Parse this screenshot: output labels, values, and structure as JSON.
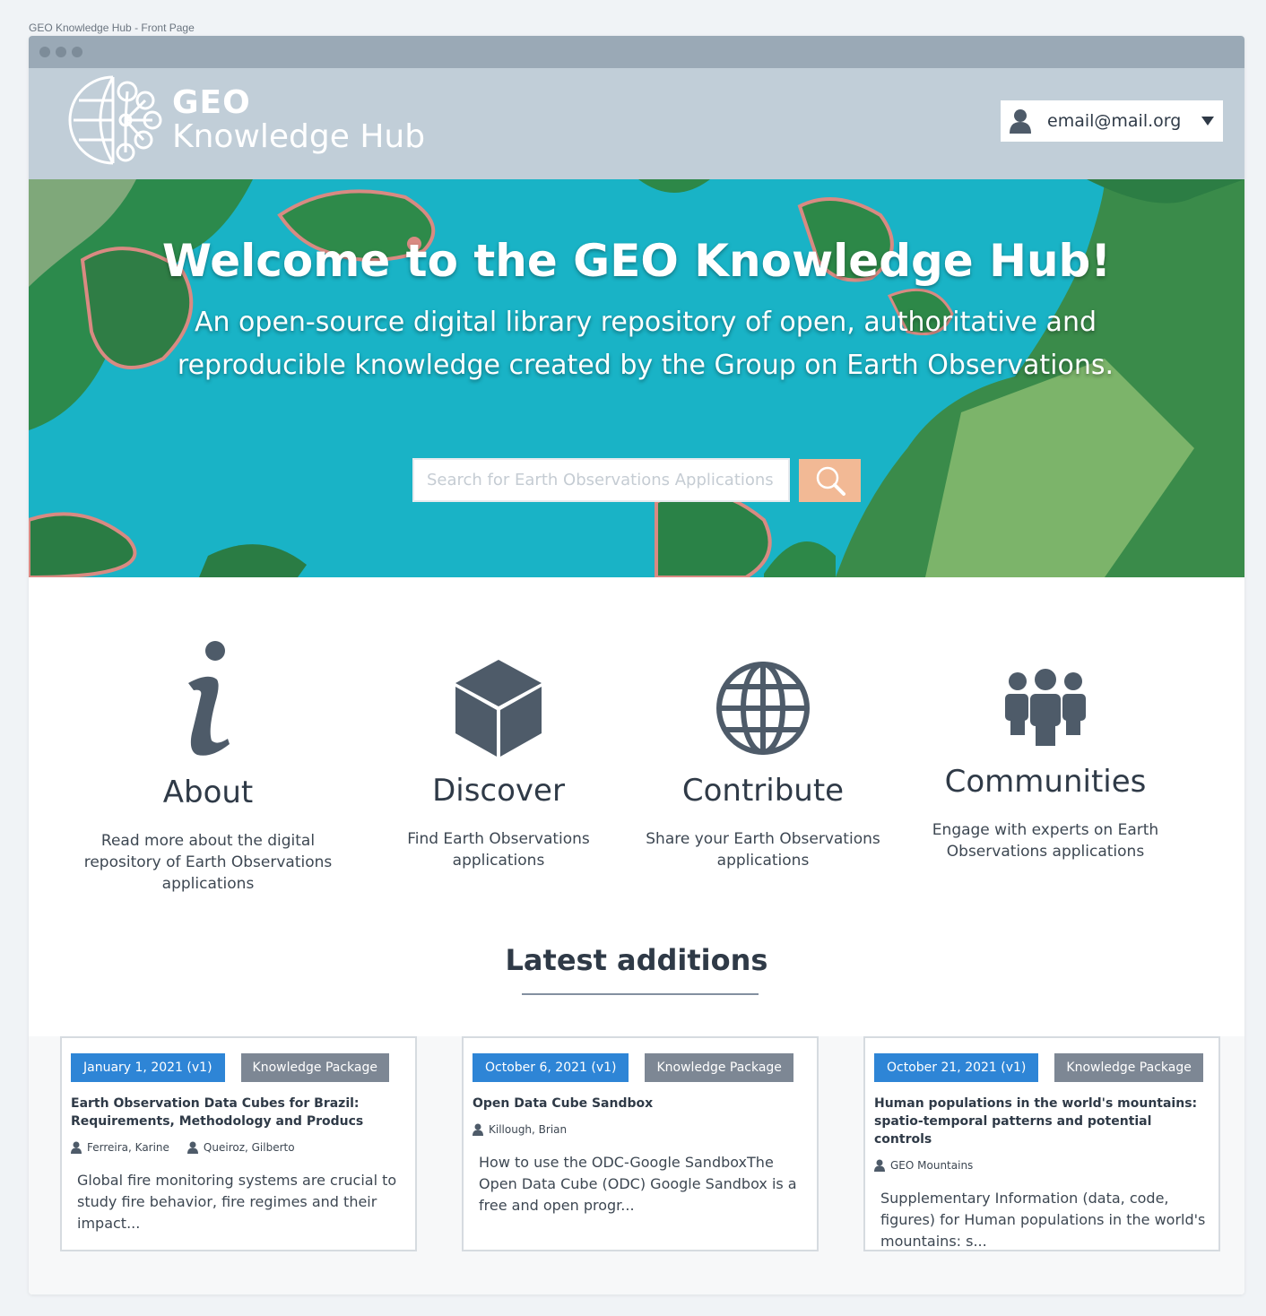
{
  "page_caption": "GEO Knowledge Hub - Front Page",
  "header": {
    "logo_geo": "GEO",
    "logo_sub": "Knowledge Hub",
    "user_email": "email@mail.org"
  },
  "hero": {
    "title": "Welcome to the GEO Knowledge Hub!",
    "subtitle": "An open-source digital library repository of open, authoritative and reproducible knowledge created by the Group on Earth Observations.",
    "search_placeholder": "Search for Earth Observations Applications"
  },
  "features": [
    {
      "icon": "info-icon",
      "title": "About",
      "text": "Read more about the digital repository of Earth Observations applications"
    },
    {
      "icon": "cube-icon",
      "title": "Discover",
      "text": "Find Earth Observations applications"
    },
    {
      "icon": "globe-icon",
      "title": "Contribute",
      "text": "Share your Earth Observations applications"
    },
    {
      "icon": "users-icon",
      "title": "Communities",
      "text": "Engage with experts on Earth Observations applications"
    }
  ],
  "latest": {
    "heading": "Latest additions",
    "cards": [
      {
        "date": "January 1, 2021 (v1)",
        "type": "Knowledge Package",
        "title": "Earth Observation Data Cubes for Brazil: Requirements, Methodology and Producs",
        "authors": [
          "Ferreira, Karine",
          "Queiroz, Gilberto"
        ],
        "description": "Global fire monitoring systems are crucial to study fire behavior, fire regimes and their impact..."
      },
      {
        "date": "October 6, 2021 (v1)",
        "type": "Knowledge Package",
        "title": "Open Data Cube Sandbox",
        "authors": [
          "Killough, Brian"
        ],
        "description": "How to use the ODC-Google SandboxThe Open Data Cube (ODC) Google Sandbox is a free and open progr..."
      },
      {
        "date": "October 21, 2021 (v1)",
        "type": "Knowledge Package",
        "title": "Human populations in the world's mountains: spatio-temporal patterns and potential controls",
        "authors": [
          "GEO Mountains"
        ],
        "description": "Supplementary Information (data, code, figures) for Human populations in the world's mountains: s..."
      }
    ]
  },
  "colors": {
    "header_bg": "#c1ced8",
    "titlebar_bg": "#9aa9b6",
    "search_button": "#f2b995",
    "date_badge": "#2e85d6",
    "type_badge": "#7d8794",
    "icon_color": "#4e5b69"
  }
}
